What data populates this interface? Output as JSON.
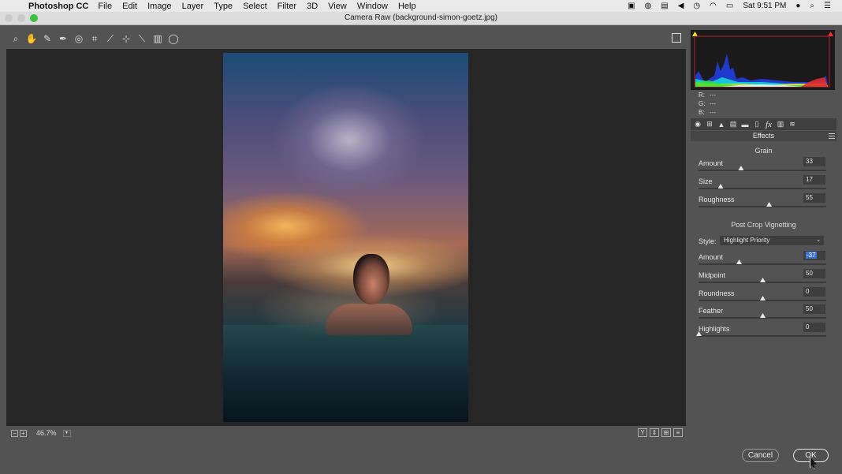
{
  "menubar": {
    "app_name": "Photoshop CC",
    "items": [
      "File",
      "Edit",
      "Image",
      "Layer",
      "Type",
      "Select",
      "Filter",
      "3D",
      "View",
      "Window",
      "Help"
    ],
    "clock": "Sat 9:51 PM"
  },
  "window": {
    "title": "Camera Raw (background-simon-goetz.jpg)"
  },
  "bottom_bar": {
    "zoom": "46.7%",
    "y_button": "Y"
  },
  "rgb_readout": {
    "r_label": "R:",
    "r_value": "---",
    "g_label": "G:",
    "g_value": "---",
    "b_label": "B:",
    "b_value": "---"
  },
  "panel": {
    "title": "Effects",
    "grain": {
      "heading": "Grain",
      "sliders": [
        {
          "label": "Amount",
          "value": "33",
          "fraction": 0.33
        },
        {
          "label": "Size",
          "value": "17",
          "fraction": 0.17
        },
        {
          "label": "Roughness",
          "value": "55",
          "fraction": 0.55
        }
      ]
    },
    "vignetting": {
      "heading": "Post Crop Vignetting",
      "style_label": "Style:",
      "style_value": "Highlight Priority",
      "sliders": [
        {
          "label": "Amount",
          "value": "-37",
          "fraction": 0.315,
          "selected": true
        },
        {
          "label": "Midpoint",
          "value": "50",
          "fraction": 0.5
        },
        {
          "label": "Roundness",
          "value": "0",
          "fraction": 0.5
        },
        {
          "label": "Feather",
          "value": "50",
          "fraction": 0.5
        },
        {
          "label": "Highlights",
          "value": "0",
          "fraction": 0.0
        }
      ]
    }
  },
  "footer": {
    "cancel_label": "Cancel",
    "ok_label": "OK"
  },
  "colors": {
    "histogram_bg": "#1a1a1a",
    "selection": "#3f6fd1"
  }
}
